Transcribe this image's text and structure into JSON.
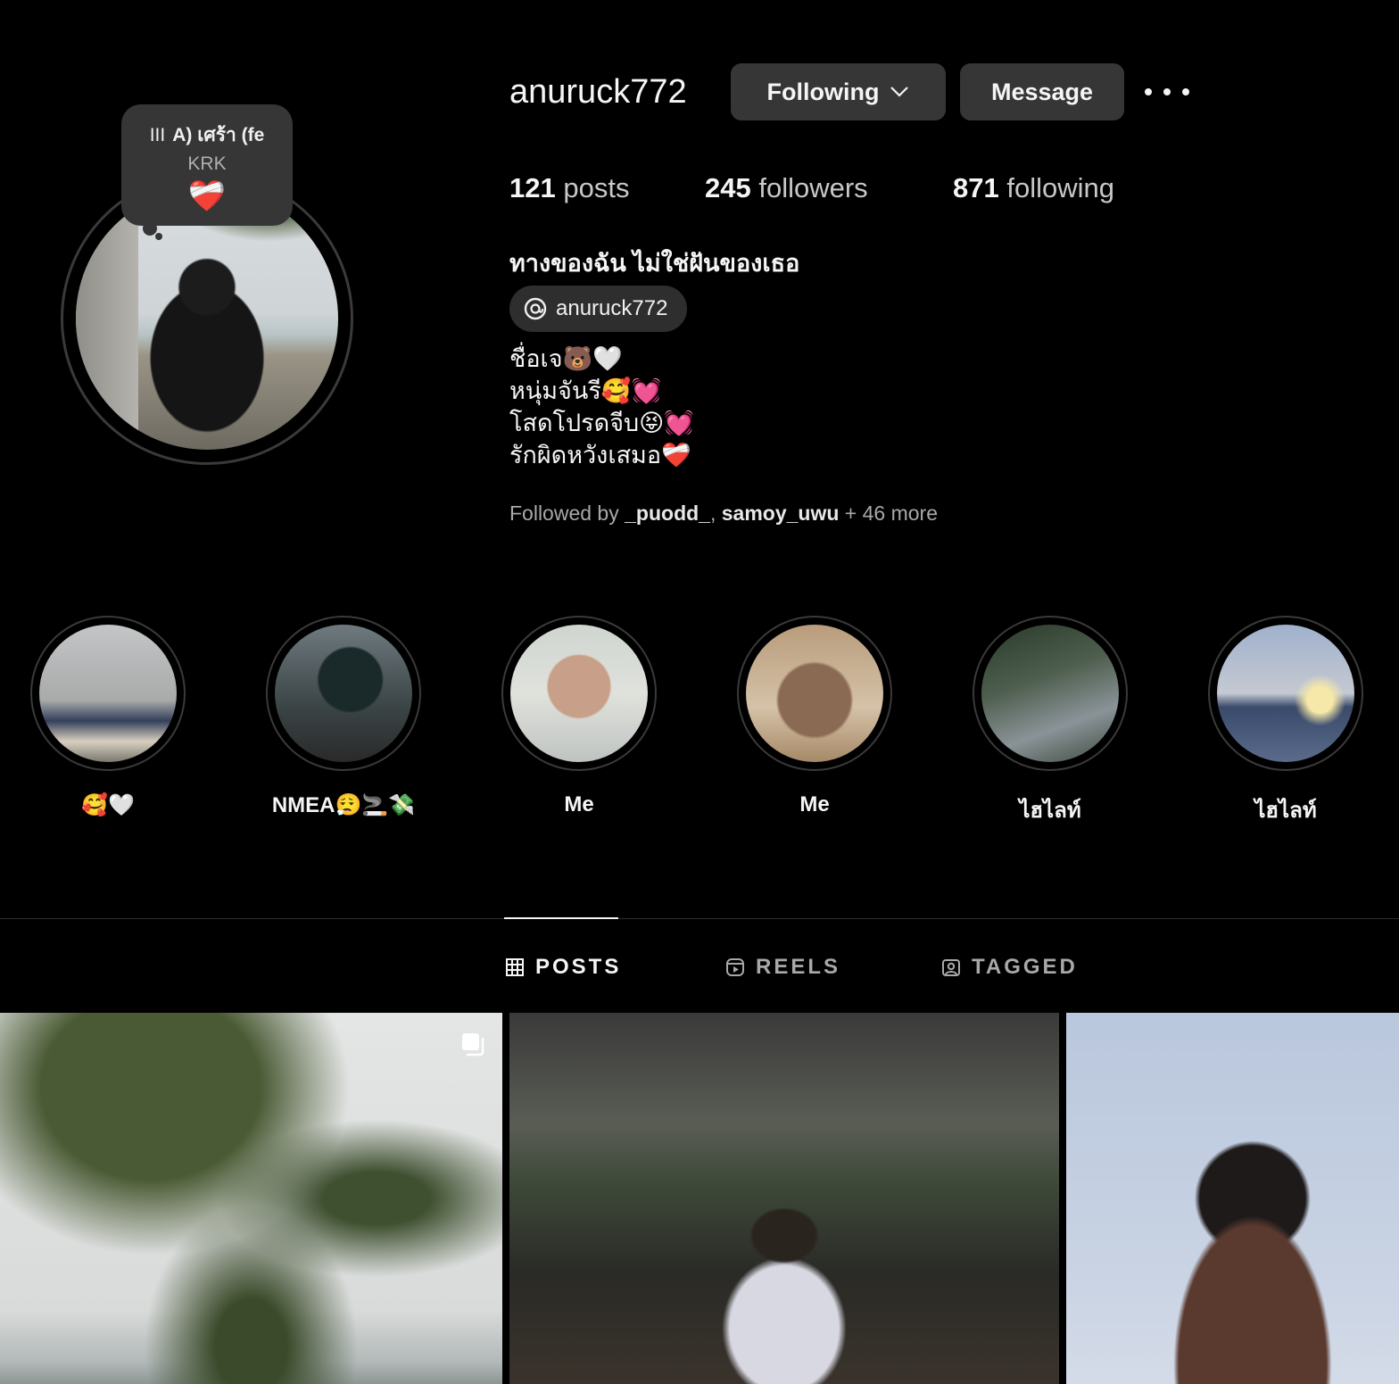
{
  "profile": {
    "username": "anuruck772",
    "following_button": "Following",
    "message_button": "Message",
    "stats": {
      "posts_count": "121",
      "posts_label": "posts",
      "followers_count": "245",
      "followers_label": "followers",
      "following_count": "871",
      "following_label": "following"
    },
    "bio_name": "ทางของฉัน ไม่ใช่ฝันของเธอ",
    "threads_handle": "anuruck772",
    "bio_lines": [
      "ชื่อเจ🐻🤍",
      "หนุ่มจันรี🥰💓",
      "โสดโปรดจีบ😝💓",
      "รักผิดหวังเสมอ❤️‍🩹"
    ],
    "followed_by_prefix": "Followed by",
    "followed_by_user1": "_puodd_",
    "followed_by_user2": "samoy_uwu",
    "followed_by_more": "+ 46 more"
  },
  "note": {
    "bars": "III",
    "title": "A)   เศร้า (fe",
    "artist": "KRK",
    "emoji": "❤️‍🩹"
  },
  "highlights": [
    {
      "label": "🥰🤍"
    },
    {
      "label": "NMEA😮‍💨🚬💸"
    },
    {
      "label": "Me"
    },
    {
      "label": "Me"
    },
    {
      "label": "ไฮไลท์"
    },
    {
      "label": "ไฮไลท์"
    }
  ],
  "tabs": {
    "posts": "POSTS",
    "reels": "REELS",
    "tagged": "TAGGED"
  },
  "icons": {
    "more": "more-horizontal-icon",
    "chevron": "chevron-down-icon",
    "threads": "threads-icon",
    "grid": "grid-icon",
    "reels": "reels-icon",
    "tagged": "tagged-icon",
    "carousel": "carousel-icon"
  },
  "colors": {
    "background": "#000000",
    "button_bg": "#363636",
    "text_primary": "#f5f5f5",
    "text_secondary": "#a8a8a8"
  }
}
